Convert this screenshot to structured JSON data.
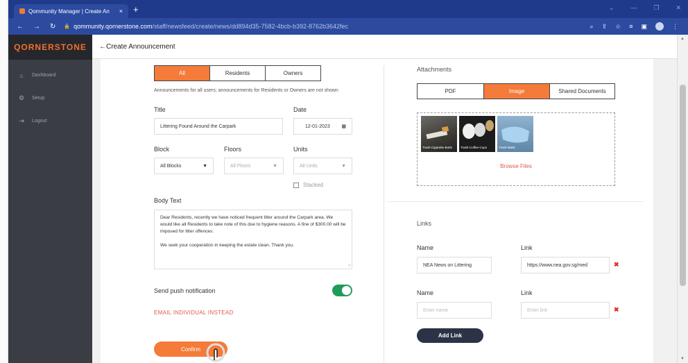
{
  "browser": {
    "tab_title": "Qommunity Manager | Create An",
    "tab_close": "×",
    "new_tab": "+",
    "url_host": "qommunity.qornerstone.com",
    "url_path": "/staff/newsfeed/create/news/dd894d35-7582-4bcb-b392-8762b3642fec"
  },
  "sidebar": {
    "brand": "QORNERSTONE",
    "items": [
      {
        "label": "Dashboard",
        "icon": "home-icon"
      },
      {
        "label": "Setup",
        "icon": "gear-icon"
      },
      {
        "label": "Logout",
        "icon": "logout-icon"
      }
    ]
  },
  "header": {
    "title": "←Create Announcement"
  },
  "audience": {
    "options": [
      "All",
      "Residents",
      "Owners"
    ],
    "selected": "All",
    "help": "Announcements for all users; announcements for Residents or Owners are not shown"
  },
  "form": {
    "title_label": "Title",
    "title_value": "Littering Found Around the Carpark",
    "date_label": "Date",
    "date_value": "12-01-2023",
    "block_label": "Block",
    "block_value": "All Blocks",
    "floors_label": "Floors",
    "floors_value": "All Floors",
    "units_label": "Units",
    "units_value": "All Units",
    "stacked_label": "Stacked",
    "body_label": "Body Text",
    "body_p1": "Dear Residents, recently we have noticed frequent litter around the Carpark area. We would like all Residents to take note of this due to hygiene reasons. A fine of $300.00 will be imposed for litter offences.",
    "body_p2": "We seek your cooperation in keeping the estate clean. Thank you.",
    "push_label": "Send push notification",
    "push_enabled": true,
    "email_link": "EMAIL INDIVIDUAL INSTEAD",
    "confirm": "Confirm"
  },
  "attachments": {
    "label": "Attachments",
    "tabs": [
      "PDF",
      "Image",
      "Shared Documents"
    ],
    "selected": "Image",
    "images": [
      "Trash-Cigarette-Butts",
      "Trash-Coffee-Cups",
      "Trash-Mask"
    ],
    "browse": "Browse Files"
  },
  "links": {
    "label": "Links",
    "name_label": "Name",
    "link_label": "Link",
    "rows": [
      {
        "name": "NEA News on Littering",
        "link": "https://www.nea.gov.sg/med"
      },
      {
        "name": "",
        "link": ""
      }
    ],
    "name_placeholder": "Enter name",
    "link_placeholder": "Enter link",
    "add": "Add Link"
  },
  "colors": {
    "accent": "#f47b3a",
    "sidebar": "#3a3d44",
    "toggle": "#1e9d5a",
    "danger": "#e2574c"
  }
}
